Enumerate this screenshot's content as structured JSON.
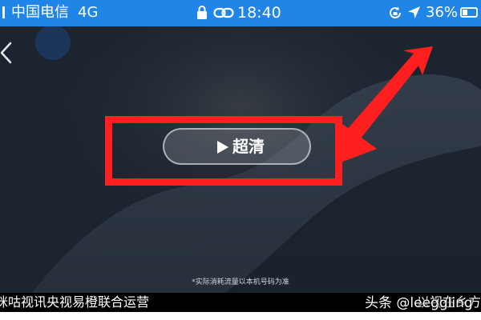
{
  "status_bar": {
    "carrier": "中国电信",
    "network": "4G",
    "time": "18:40",
    "battery_percent": "36%",
    "battery_level": 0.36,
    "icons": [
      "signal-icon",
      "lock-icon",
      "link-icon",
      "rotation-lock-icon",
      "location-arrow-icon",
      "battery-icon"
    ]
  },
  "player": {
    "play_button_label": "超清",
    "note": "*实际消耗流量以本机号码为准"
  },
  "bottom_bar": {
    "ticker_text": "咪咕视讯央视易橙联合运营",
    "ticker_right": "以视在乡方龙"
  },
  "watermark": "头条 @leeggling",
  "colors": {
    "status_bar": "#1f86e8",
    "player_bg": "#1c2430",
    "highlight": "#ff1f1f"
  }
}
